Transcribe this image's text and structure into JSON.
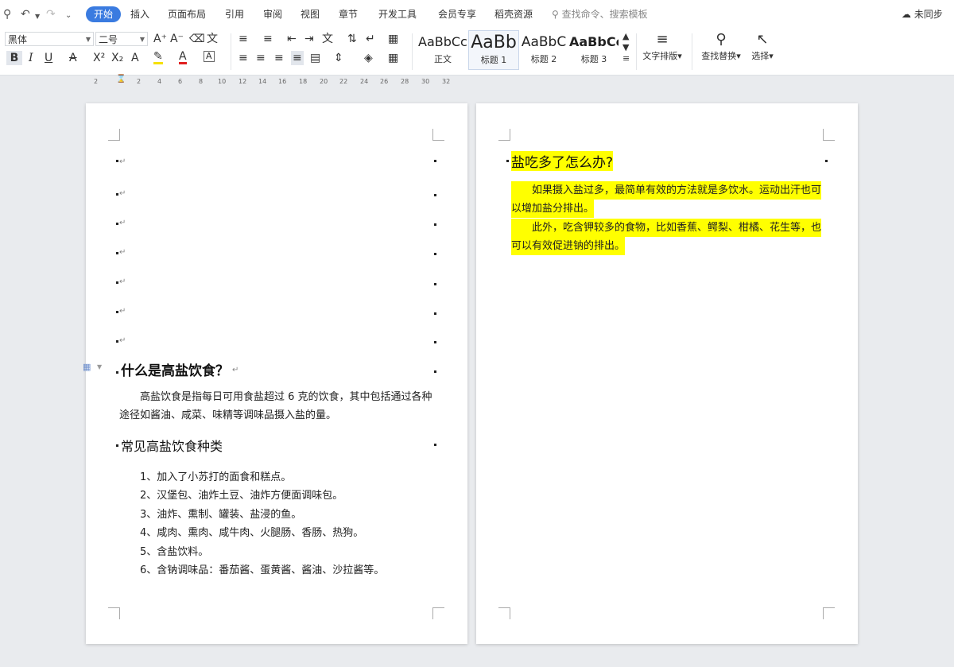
{
  "menu": {
    "tabs": [
      "开始",
      "插入",
      "页面布局",
      "引用",
      "审阅",
      "视图",
      "章节",
      "开发工具",
      "会员专享",
      "稻壳资源"
    ],
    "active_tab": "开始",
    "search_placeholder": "查找命令、搜索模板",
    "sync_status": "未同步"
  },
  "ribbon": {
    "font_name": "黑体",
    "font_size": "二号",
    "styles": [
      {
        "sample": "AaBbCcDd",
        "name": "正文"
      },
      {
        "sample": "AaBb",
        "name": "标题 1"
      },
      {
        "sample": "AaBbC",
        "name": "标题 2"
      },
      {
        "sample": "AaBbCc",
        "name": "标题 3"
      }
    ],
    "text_layout_label": "文字排版",
    "find_replace_label": "查找替换",
    "select_label": "选择"
  },
  "ruler": {
    "ticks": [
      "2",
      "",
      "2",
      "4",
      "6",
      "8",
      "10",
      "12",
      "14",
      "16",
      "18",
      "20",
      "22",
      "24",
      "26",
      "28",
      "30",
      "32"
    ]
  },
  "page1": {
    "heading1": "什么是高盐饮食？",
    "paragraph1": "高盐饮食是指每日可用食盐超过 6 克的饮食，其中包括通过各种途径如酱油、咸菜、味精等调味品摄入盐的量。",
    "heading2": "常见高盐饮食种类",
    "list": [
      "1、加入了小苏打的面食和糕点。",
      "2、汉堡包、油炸土豆、油炸方便面调味包。",
      "3、油炸、熏制、罐装、盐浸的鱼。",
      "4、咸肉、熏肉、咸牛肉、火腿肠、香肠、热狗。",
      "5、含盐饮料。",
      "6、含钠调味品：番茄酱、蛋黄酱、酱油、沙拉酱等。"
    ]
  },
  "page2": {
    "heading": "盐吃多了怎么办?",
    "para1_line1": "如果摄入盐过多，最简单有效的方法就是多饮水。运动出汗也可",
    "para1_line2": "以增加盐分排出。",
    "para2_line1": "此外，吃含钾较多的食物，比如香蕉、鳄梨、柑橘、花生等，也",
    "para2_line2": "可以有效促进钠的排出。"
  }
}
